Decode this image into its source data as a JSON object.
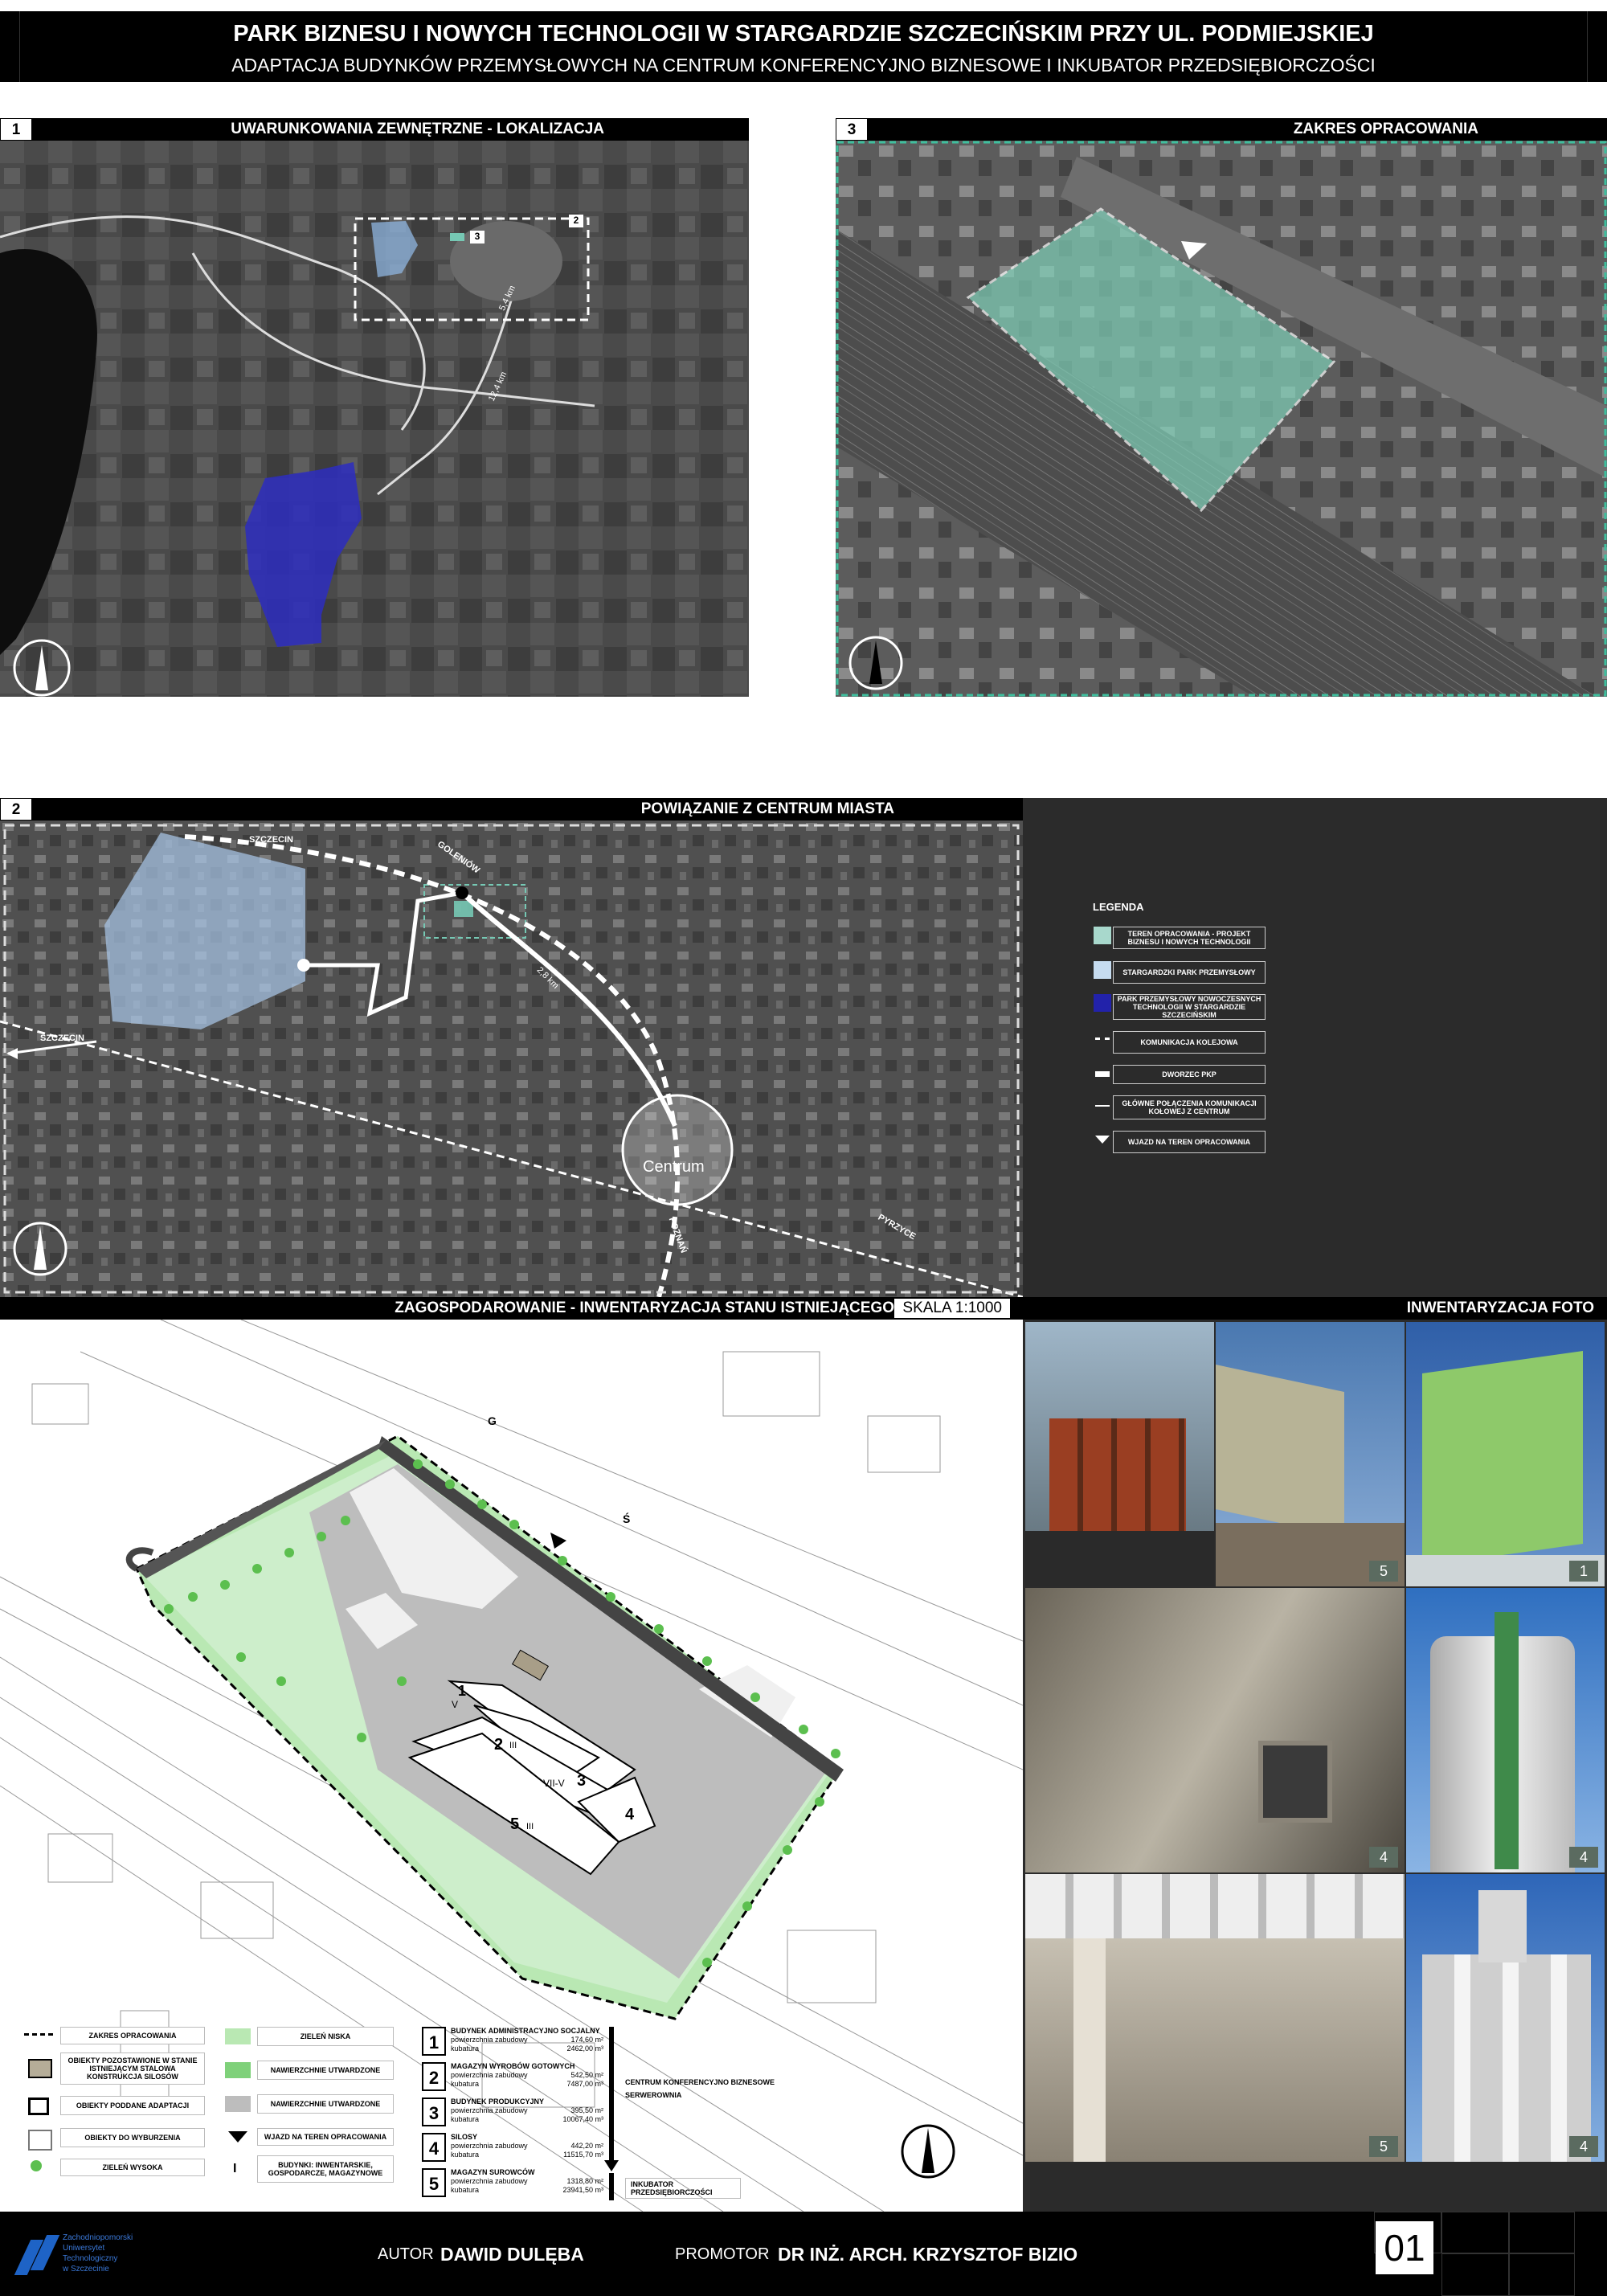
{
  "header": {
    "title": "PARK BIZNESU I NOWYCH TECHNOLOGII W STARGARDZIE SZCZECIŃSKIM PRZY UL. PODMIEJSKIEJ",
    "subtitle": "ADAPTACJA BUDYNKÓW PRZEMYSŁOWYCH NA CENTRUM KONFERENCYJNO BIZNESOWE I INKUBATOR PRZEDSIĘBIORCZOŚCI"
  },
  "sections": {
    "s1": {
      "num": "1",
      "title": "UWARUNKOWANIA ZEWNĘTRZNE - LOKALIZACJA"
    },
    "s3": {
      "num": "3",
      "title": "ZAKRES OPRACOWANIA"
    },
    "s2": {
      "num": "2",
      "title": "POWIĄZANIE Z CENTRUM MIASTA"
    },
    "plan": {
      "title": "ZAGOSPODAROWANIE - INWENTARYZACJA STANU ISTNIEJĄCEGO",
      "scale": "SKALA 1:1000"
    },
    "photos": {
      "title": "INWENTARYZACJA FOTO"
    }
  },
  "map1": {
    "marker2": "2",
    "marker3": "3",
    "dist1": "5,4 km",
    "dist2": "12,4 km"
  },
  "map2": {
    "centrum": "Centrum",
    "label_szczecin_top": "SZCZECIN",
    "label_szczecin_left": "SZCZECIN",
    "label_goleniow": "GOLENIÓW",
    "label_pyrzyce": "PYRZYCE",
    "label_poznan": "POZNAŃ",
    "dist": "2,8 km"
  },
  "legend": {
    "title": "LEGENDA",
    "items": [
      {
        "label": "TEREN OPRACOWANIA - PROJEKT BIZNESU I NOWYCH TECHNOLOGII",
        "swatch": "#a8d8cc"
      },
      {
        "label": "STARGARDZKI PARK PRZEMYSŁOWY",
        "swatch": "#c6dcf0"
      },
      {
        "label": "PARK PRZEMYSŁOWY NOWOCZESNYCH TECHNOLOGII W STARGARDZIE SZCZECIŃSKIM",
        "swatch": "#2222aa"
      },
      {
        "label": "KOMUNIKACJA KOLEJOWA",
        "swatch": "dash"
      },
      {
        "label": "DWORZEC PKP",
        "swatch": "bar"
      },
      {
        "label": "GŁÓWNE POŁĄCZENIA KOMUNIKACJI KOŁOWEJ Z CENTRUM",
        "swatch": "line"
      },
      {
        "label": "WJAZD NA TEREN OPRACOWANIA",
        "swatch": "arrow"
      }
    ]
  },
  "plan": {
    "labels": {
      "g": "G",
      "s": "Ś"
    },
    "buildings": [
      {
        "num": "1",
        "roman": "V"
      },
      {
        "num": "2",
        "roman": "III"
      },
      {
        "num": "3",
        "roman": "VII-V"
      },
      {
        "num": "4",
        "roman": ""
      },
      {
        "num": "5",
        "roman": "III"
      }
    ],
    "legend_left": [
      "ZAKRES OPRACOWANIA",
      "OBIEKTY POZOSTAWIONE W STANIE ISTNIEJĄCYM STALOWA KONSTRUKCJA SILOSÓW",
      "OBIEKTY PODDANE ADAPTACJI",
      "OBIEKTY DO WYBURZENIA",
      "ZIELEŃ WYSOKA"
    ],
    "legend_mid": [
      "ZIELEŃ NISKA",
      "NAWIERZCHNIE UTWARDZONE",
      "NAWIERZCHNIE UTWARDZONE",
      "WJAZD NA TEREN OPRACOWANIA",
      "BUDYNKI: INWENTARSKIE, GOSPODARCZE, MAGAZYNOWE"
    ],
    "legend_mid_symbol": "I",
    "building_table": [
      {
        "num": "1",
        "name": "BUDYNEK ADMINISTRACYJNO SOCJALNY",
        "area_label": "powierzchnia zabudowy",
        "area": "174,60 m²",
        "vol_label": "kubatura",
        "vol": "2462,00 m³"
      },
      {
        "num": "2",
        "name": "MAGAZYN WYROBÓW GOTOWYCH",
        "area_label": "powierzchnia zabudowy",
        "area": "542,50 m²",
        "vol_label": "kubatura",
        "vol": "7487,00 m³"
      },
      {
        "num": "3",
        "name": "BUDYNEK PRODUKCYJNY",
        "area_label": "powierzchnia zabudowy",
        "area": "395,50 m²",
        "vol_label": "kubatura",
        "vol": "10067,40 m³"
      },
      {
        "num": "4",
        "name": "SILOSY",
        "area_label": "powierzchnia zabudowy",
        "area": "442,20 m²",
        "vol_label": "kubatura",
        "vol": "11515,70 m³"
      },
      {
        "num": "5",
        "name": "MAGAZYN SUROWCÓW",
        "area_label": "powierzchnia zabudowy",
        "area": "1318,80 m²",
        "vol_label": "kubatura",
        "vol": "23941,50 m³"
      }
    ],
    "function_labels": [
      "CENTRUM KONFERENCYJNO BIZNESOWE",
      "SERWEROWNIA",
      "INKUBATOR PRZEDSIĘBIORCZOŚCI"
    ]
  },
  "photos": [
    {
      "num": ""
    },
    {
      "num": "5"
    },
    {
      "num": "1"
    },
    {
      "num": "4"
    },
    {
      "num": "4"
    },
    {
      "num": "5"
    },
    {
      "num": "4"
    }
  ],
  "footer": {
    "uni_line1": "Zachodniopomorski",
    "uni_line2": "Uniwersytet",
    "uni_line3": "Technologiczny",
    "uni_line4": "w Szczecinie",
    "author_label": "AUTOR",
    "author": "DAWID DULĘBA",
    "promotor_label": "PROMOTOR",
    "promotor": "DR INŻ. ARCH. KRZYSZTOF BIZIO",
    "sheet": "01"
  },
  "colors": {
    "accent_green": "#7fd17a",
    "site_teal": "#76c8b4",
    "park_blue": "#2b2bb0",
    "dark_panel": "#2b2b2b"
  }
}
